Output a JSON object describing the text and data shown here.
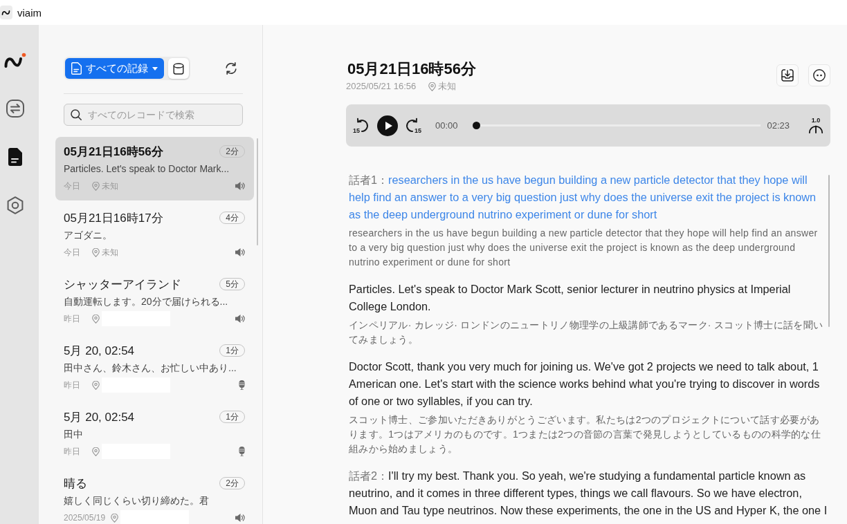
{
  "app": {
    "title": "viaim"
  },
  "nav": [
    {
      "kind": "transfer",
      "selected": false
    },
    {
      "kind": "records",
      "selected": true
    },
    {
      "kind": "settings",
      "selected": false
    }
  ],
  "list": {
    "filter": "すべての記録",
    "search": {
      "placeholder": "すべてのレコードで検索"
    },
    "items": [
      {
        "title": "05月21日16時56分",
        "duration": "2分",
        "preview": "Particles. Let's speak to Doctor Mark...",
        "date": "今日",
        "location": "未知",
        "location_hidden": false,
        "kind": "speaker",
        "selected": true
      },
      {
        "title": "05月21日16時17分",
        "duration": "4分",
        "preview": "アゴダニ。",
        "date": "今日",
        "location": "未知",
        "location_hidden": false,
        "kind": "speaker",
        "selected": false
      },
      {
        "title": "シャッターアイランド",
        "duration": "5分",
        "preview": "自動運転します。20分で届けられる...",
        "date": "昨日",
        "location_hidden": true,
        "kind": "speaker",
        "selected": false
      },
      {
        "title": "5月 20, 02:54",
        "duration": "1分",
        "preview": "田中さん、鈴木さん、お忙しい中あり...",
        "date": "昨日",
        "location_hidden": true,
        "kind": "microphone",
        "selected": false
      },
      {
        "title": "5月 20, 02:54",
        "duration": "1分",
        "preview": "田中",
        "date": "昨日",
        "location_hidden": true,
        "kind": "microphone",
        "selected": false
      },
      {
        "title": "晴る",
        "duration": "2分",
        "preview": "嬉しく同じくらい切り締めた。君",
        "date": "2025/05/19",
        "location_hidden": true,
        "kind": "speaker",
        "selected": false
      }
    ]
  },
  "detail": {
    "title": "05月21日16時56分",
    "timestamp": "2025/05/21 16:56",
    "location": "未知",
    "player": {
      "rewind": "15",
      "forward": "15",
      "elapsed": "00:00",
      "level": 0,
      "total": "02:23",
      "speed": "1.0"
    },
    "transcript": [
      {
        "speaker": "話者1：",
        "text": "researchers in the us have begun building a new particle detector that they hope will help find an answer to a very big question just why does the universe exit the project is known as the deep underground nutrino experiment or dune for short",
        "translation": "researchers in the us have begun building a new particle detector that they hope will help find an answer to a very big question just why does the universe exit the project is known as the deep underground nutrino experiment or dune for short",
        "active": true
      },
      {
        "text": "Particles. Let's speak to Doctor Mark Scott, senior lecturer in neutrino physics at Imperial College London.",
        "translation": "インペリアル· カレッジ· ロンドンのニュートリノ物理学の上級講師であるマーク· スコット博士に話を聞いてみましょう。",
        "active": false
      },
      {
        "text": "Doctor Scott, thank you very much for joining us. We've got 2 projects we need to talk about, 1 American one. Let's start with the science works behind what you're trying to discover in words of one or two syllables, if you can try.",
        "translation": "スコット博士、ご参加いただきありがとうございます。私たちは2つのプロジェクトについて話す必要があります。1つはアメリカのものです。1つまたは2つの音節の言葉で発見しようとしているものの科学的な仕組みから始めましょう。",
        "active": false
      },
      {
        "speaker": "話者2：",
        "text": "I'll try my best. Thank you. So yeah, we're studying a fundamental particle known as neutrino, and it comes in three different types, things we call flavours. So we have electron, Muon and Tau type neutrinos. Now these experiments, the one in the US and Hyper K, the one I",
        "active": false
      }
    ]
  }
}
